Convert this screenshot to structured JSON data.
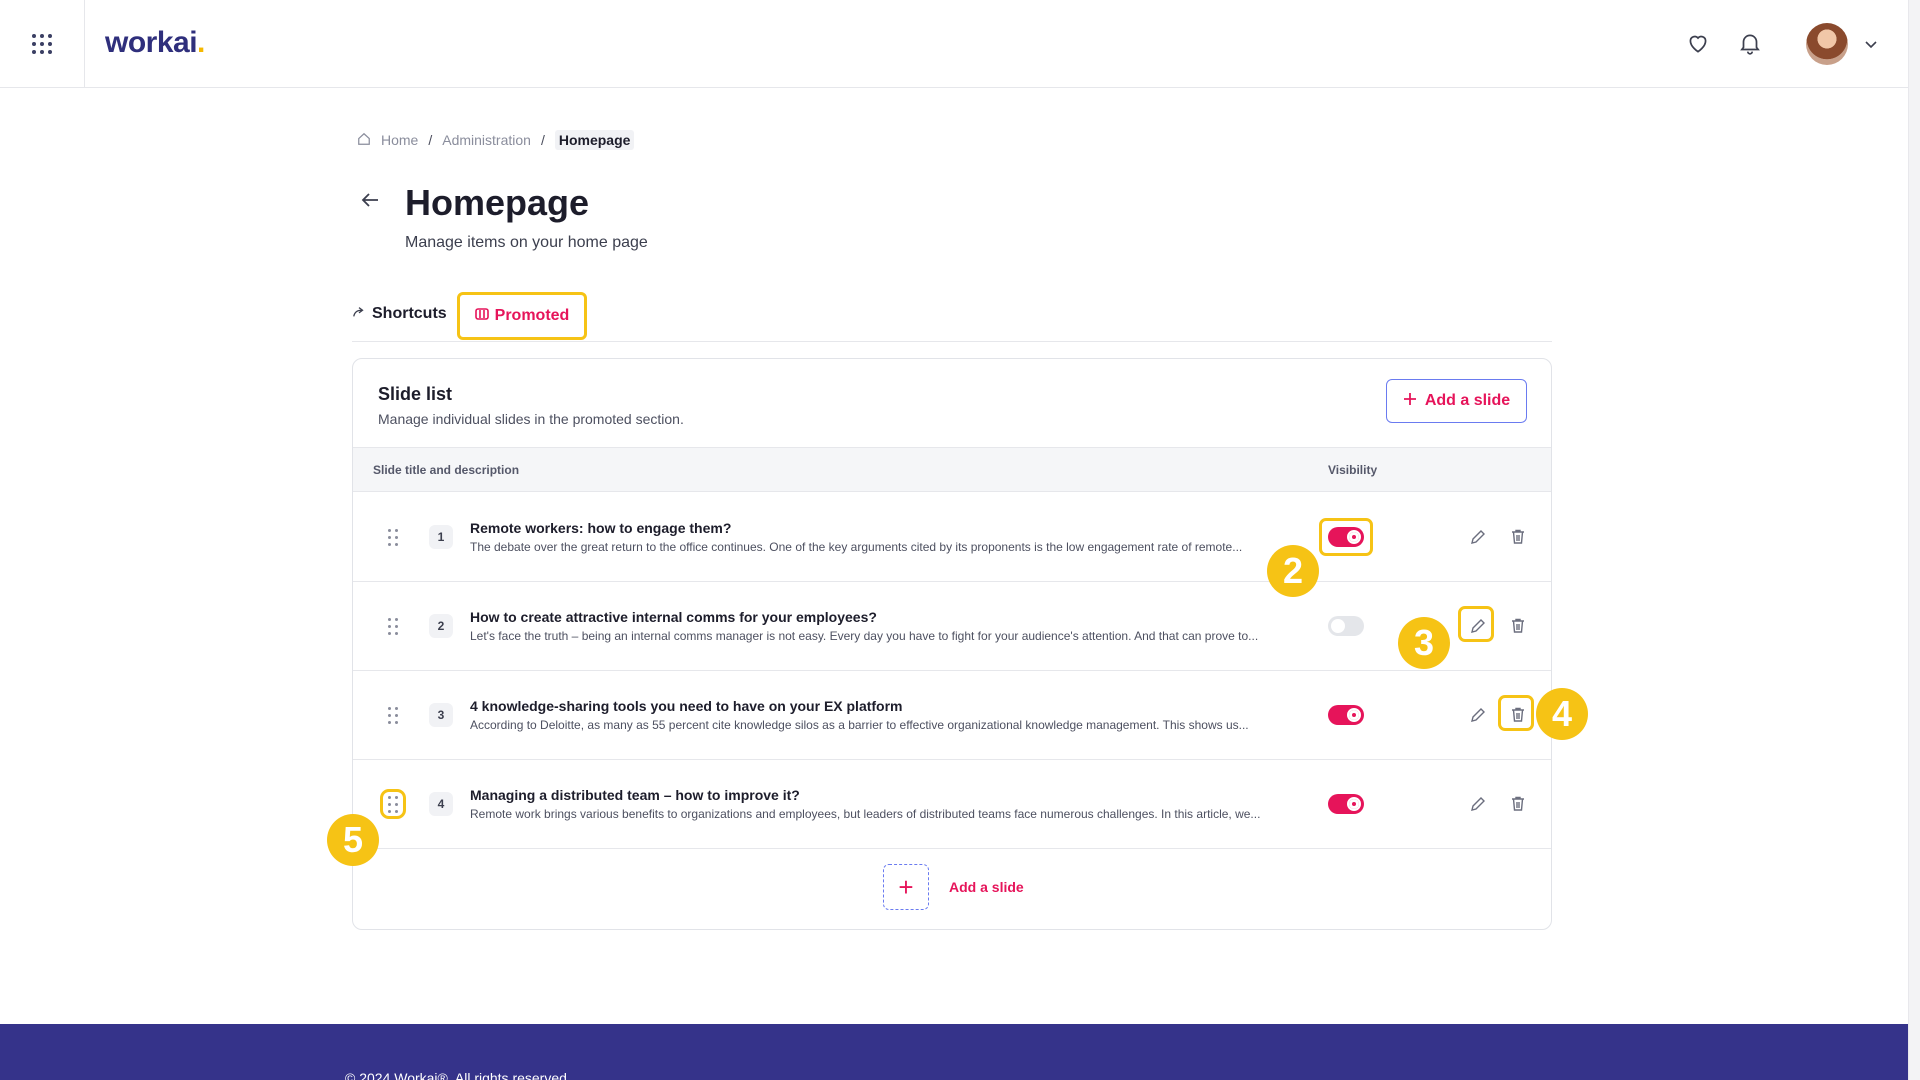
{
  "header": {
    "logo_text": "workai",
    "logo_dot": "."
  },
  "breadcrumb": {
    "home": "Home",
    "sep1": "/",
    "administration": "Administration",
    "sep2": "/",
    "current": "Homepage"
  },
  "page": {
    "title": "Homepage",
    "subtitle": "Manage items on your home page"
  },
  "tabs": [
    {
      "label": "Shortcuts"
    },
    {
      "label": "Promoted"
    }
  ],
  "slide_list": {
    "title": "Slide list",
    "subtitle": "Manage individual slides in the promoted section.",
    "add_button_label": "Add a slide",
    "column_title": "Slide title and description",
    "column_visibility": "Visibility",
    "rows": [
      {
        "num": "1",
        "title": "Remote workers: how to engage them?",
        "desc": "The debate over the great return to the office continues. One of the key arguments cited by its proponents is the low engagement rate of remote...",
        "visible": true
      },
      {
        "num": "2",
        "title": "How to create attractive internal comms for your employees?",
        "desc": "Let's face the truth – being an internal comms manager is not easy. Every day you have to fight for your audience's attention. And that can prove to...",
        "visible": false
      },
      {
        "num": "3",
        "title": "4 knowledge-sharing tools you need to have on your EX platform",
        "desc": "According to Deloitte, as many as 55 percent cite knowledge silos as a barrier to effective organizational knowledge management. This shows us...",
        "visible": true
      },
      {
        "num": "4",
        "title": "Managing a distributed team – how to improve it?",
        "desc": "Remote work brings various benefits to organizations and employees, but leaders of distributed teams face numerous challenges. In this article, we...",
        "visible": true
      }
    ],
    "add_bottom_label": "Add a slide",
    "add_bottom_plus": "+"
  },
  "annotations": {
    "b2": "2",
    "b3": "3",
    "b4": "4",
    "b5": "5"
  },
  "footer": {
    "text": "© 2024 Workai®. All rights reserved."
  },
  "colors": {
    "accent": "#e6145a",
    "brand": "#2f2f7c",
    "highlight": "#f6c315",
    "footer_bg": "#35338a"
  }
}
